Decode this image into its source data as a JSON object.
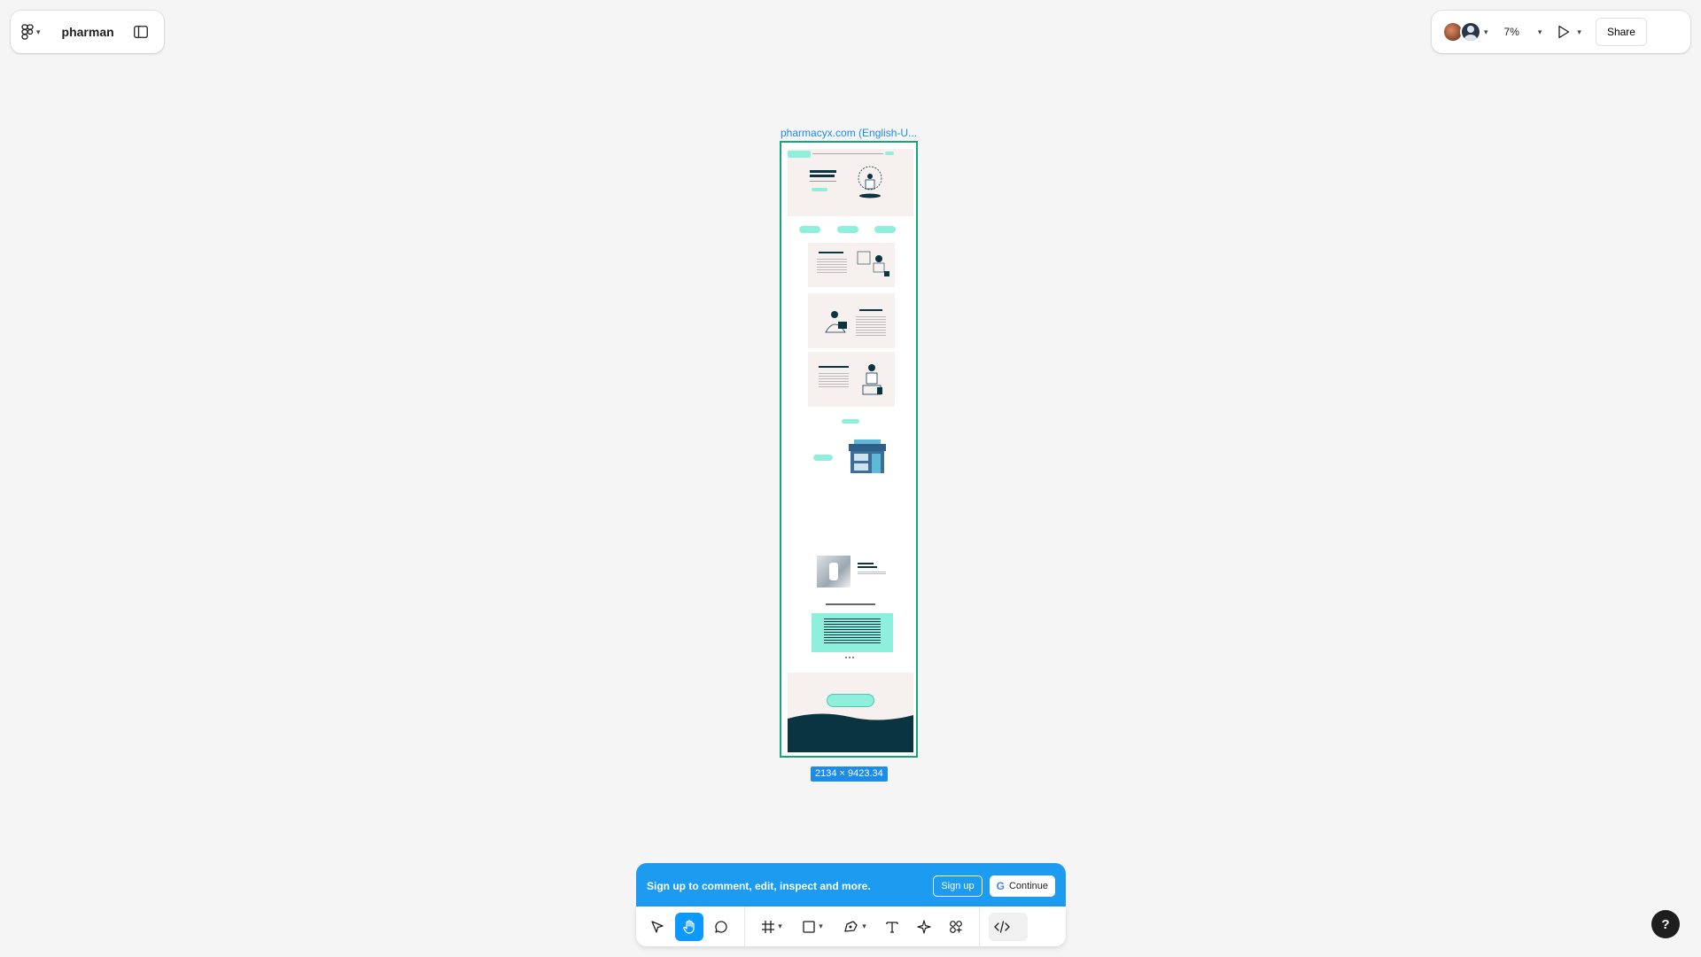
{
  "header": {
    "file_name": "pharman",
    "zoom": "7%",
    "share_label": "Share"
  },
  "canvas": {
    "frame_name": "pharmacyx.com (English-U...",
    "frame_size": "2134 × 9423.34"
  },
  "signup_banner": {
    "message": "Sign up to comment, edit, inspect and more.",
    "signup_label": "Sign up",
    "continue_label": "Continue"
  },
  "toolbar": {
    "tools": [
      "move",
      "hand",
      "comment",
      "frame",
      "rectangle",
      "pen",
      "text",
      "actions",
      "resources",
      "dev-mode"
    ]
  },
  "help": {
    "label": "?"
  },
  "colors": {
    "accent": "#0d99ff",
    "frame_outline": "#14a67a",
    "mint": "#8ef0dc",
    "dark_navy": "#0b3442"
  }
}
